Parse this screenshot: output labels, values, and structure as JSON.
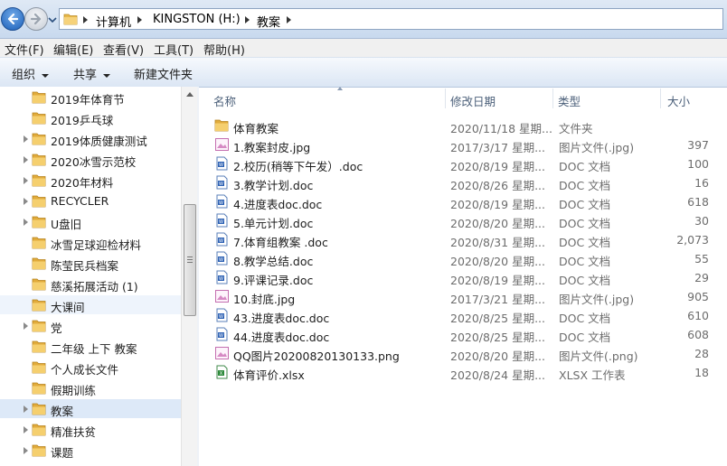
{
  "address": {
    "segments": [
      "计算机",
      "KINGSTON (H:)",
      "教案"
    ]
  },
  "menu": [
    "文件(F)",
    "编辑(E)",
    "查看(V)",
    "工具(T)",
    "帮助(H)"
  ],
  "toolbar": {
    "organize": "组织",
    "share": "共享",
    "new_folder": "新建文件夹"
  },
  "tree": [
    {
      "label": "2019年体育节",
      "expandable": false
    },
    {
      "label": "2019乒乓球",
      "expandable": false
    },
    {
      "label": "2019体质健康测试",
      "expandable": true
    },
    {
      "label": "2020冰雪示范校",
      "expandable": true
    },
    {
      "label": "2020年材料",
      "expandable": true
    },
    {
      "label": "RECYCLER",
      "expandable": true
    },
    {
      "label": "U盘旧",
      "expandable": true
    },
    {
      "label": "冰雪足球迎检材料",
      "expandable": false
    },
    {
      "label": "陈莹民兵档案",
      "expandable": false
    },
    {
      "label": "慈溪拓展活动 (1)",
      "expandable": false
    },
    {
      "label": "大课间",
      "expandable": false
    },
    {
      "label": "党",
      "expandable": true
    },
    {
      "label": "二年级 上下 教案",
      "expandable": false
    },
    {
      "label": "个人成长文件",
      "expandable": false
    },
    {
      "label": "假期训练",
      "expandable": false
    },
    {
      "label": "教案",
      "expandable": true
    },
    {
      "label": "精准扶贫",
      "expandable": true
    },
    {
      "label": "课题",
      "expandable": true
    }
  ],
  "columns": {
    "name": "名称",
    "date": "修改日期",
    "type": "类型",
    "size": "大小"
  },
  "files": [
    {
      "name": "体育教案",
      "date": "2020/11/18 星期...",
      "type": "文件夹",
      "size": "",
      "icon": "folder-icon"
    },
    {
      "name": "1.教案封皮.jpg",
      "date": "2017/3/17 星期...",
      "type": "图片文件(.jpg)",
      "size": "397",
      "icon": "image-file-icon"
    },
    {
      "name": "2.校历(稍等下午发）.doc",
      "date": "2020/8/19 星期...",
      "type": "DOC 文档",
      "size": "100",
      "icon": "doc-file-icon"
    },
    {
      "name": "3.教学计划.doc",
      "date": "2020/8/26 星期...",
      "type": "DOC 文档",
      "size": "16",
      "icon": "doc-file-icon"
    },
    {
      "name": "4.进度表doc.doc",
      "date": "2020/8/19 星期...",
      "type": "DOC 文档",
      "size": "618",
      "icon": "doc-file-icon"
    },
    {
      "name": "5.单元计划.doc",
      "date": "2020/8/20 星期...",
      "type": "DOC 文档",
      "size": "30",
      "icon": "doc-file-icon"
    },
    {
      "name": "7.体育组教案 .doc",
      "date": "2020/8/31 星期...",
      "type": "DOC 文档",
      "size": "2,073",
      "icon": "doc-file-icon"
    },
    {
      "name": "8.教学总结.doc",
      "date": "2020/8/20 星期...",
      "type": "DOC 文档",
      "size": "55",
      "icon": "doc-file-icon"
    },
    {
      "name": "9.评课记录.doc",
      "date": "2020/8/19 星期...",
      "type": "DOC 文档",
      "size": "29",
      "icon": "doc-file-icon"
    },
    {
      "name": "10.封底.jpg",
      "date": "2017/3/21 星期...",
      "type": "图片文件(.jpg)",
      "size": "905",
      "icon": "image-file-icon"
    },
    {
      "name": "43.进度表doc.doc",
      "date": "2020/8/25 星期...",
      "type": "DOC 文档",
      "size": "610",
      "icon": "doc-file-icon"
    },
    {
      "name": "44.进度表doc.doc",
      "date": "2020/8/25 星期...",
      "type": "DOC 文档",
      "size": "608",
      "icon": "doc-file-icon"
    },
    {
      "name": "QQ图片20200820130133.png",
      "date": "2020/8/20 星期...",
      "type": "图片文件(.png)",
      "size": "28",
      "icon": "image-file-icon"
    },
    {
      "name": "体育评价.xlsx",
      "date": "2020/8/24 星期...",
      "type": "XLSX 工作表",
      "size": "18",
      "icon": "xlsx-file-icon"
    }
  ],
  "colors": {
    "selection": "#dde9f8",
    "accent": "#1b5fb8"
  }
}
